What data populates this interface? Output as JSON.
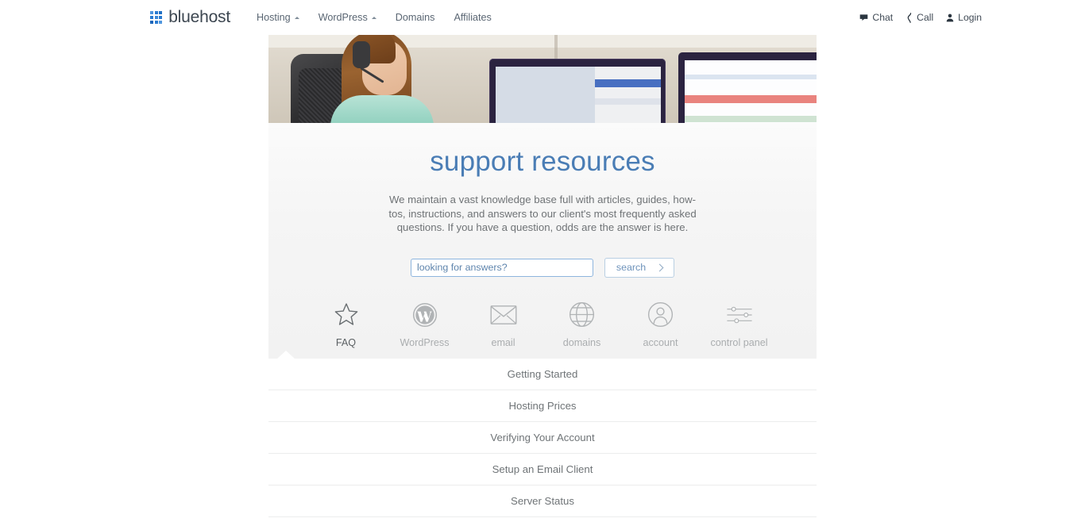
{
  "brand": {
    "name": "bluehost",
    "logo_icon": "grid-squares-icon",
    "accent": "#2a7bd1"
  },
  "nav": {
    "main": [
      {
        "label": "Hosting",
        "has_dropdown": true
      },
      {
        "label": "WordPress",
        "has_dropdown": true
      },
      {
        "label": "Domains",
        "has_dropdown": false
      },
      {
        "label": "Affiliates",
        "has_dropdown": false
      }
    ],
    "right": [
      {
        "label": "Chat",
        "icon": "chat-bubble-icon"
      },
      {
        "label": "Call",
        "icon": "phone-icon"
      },
      {
        "label": "Login",
        "icon": "user-icon"
      }
    ]
  },
  "hero": {
    "image_alt": "support agent with headset at computer workstation",
    "title": "support resources",
    "title_color": "#4a7db5",
    "description": "We maintain a vast knowledge base full with articles, guides, how-tos, instructions, and answers to our client's most frequently asked questions. If you have a question, odds are the answer is here."
  },
  "search": {
    "placeholder": "looking for answers?",
    "value": "",
    "button_label": "search",
    "button_icon": "chevron-right-icon"
  },
  "tabs": [
    {
      "label": "FAQ",
      "icon": "star-icon",
      "active": true
    },
    {
      "label": "WordPress",
      "icon": "wordpress-icon",
      "active": false
    },
    {
      "label": "email",
      "icon": "envelope-icon",
      "active": false
    },
    {
      "label": "domains",
      "icon": "globe-icon",
      "active": false
    },
    {
      "label": "account",
      "icon": "user-circle-icon",
      "active": false
    },
    {
      "label": "control panel",
      "icon": "sliders-icon",
      "active": false
    }
  ],
  "faq_items": [
    {
      "label": "Getting Started"
    },
    {
      "label": "Hosting Prices"
    },
    {
      "label": "Verifying Your Account"
    },
    {
      "label": "Setup an Email Client"
    },
    {
      "label": "Server Status"
    }
  ]
}
